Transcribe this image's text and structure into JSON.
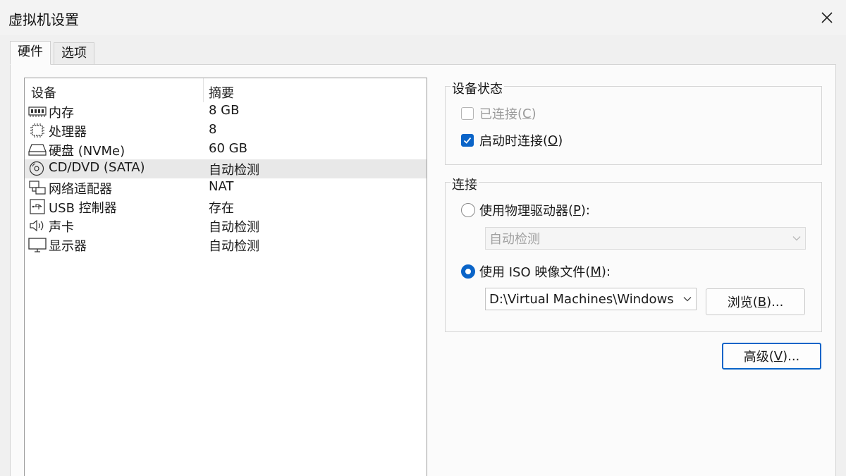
{
  "window": {
    "title": "虚拟机设置"
  },
  "tabs": [
    {
      "label": "硬件",
      "active": true
    },
    {
      "label": "选项",
      "active": false
    }
  ],
  "device_list": {
    "columns": [
      "设备",
      "摘要"
    ],
    "rows": [
      {
        "icon": "memory-icon",
        "name": "内存",
        "summary": "8 GB",
        "selected": false
      },
      {
        "icon": "processor-icon",
        "name": "处理器",
        "summary": "8",
        "selected": false
      },
      {
        "icon": "hard-disk-icon",
        "name": "硬盘 (NVMe)",
        "summary": "60 GB",
        "selected": false
      },
      {
        "icon": "cd-dvd-icon",
        "name": "CD/DVD (SATA)",
        "summary": "自动检测",
        "selected": true
      },
      {
        "icon": "network-adapter-icon",
        "name": "网络适配器",
        "summary": "NAT",
        "selected": false
      },
      {
        "icon": "usb-icon",
        "name": "USB 控制器",
        "summary": "存在",
        "selected": false
      },
      {
        "icon": "speaker-icon",
        "name": "声卡",
        "summary": "自动检测",
        "selected": false
      },
      {
        "icon": "monitor-icon",
        "name": "显示器",
        "summary": "自动检测",
        "selected": false
      }
    ]
  },
  "device_status": {
    "label": "设备状态",
    "connected": {
      "label": "已连接",
      "mnemonic": "C",
      "checked": false,
      "enabled": false
    },
    "connect_on_start": {
      "label": "启动时连接",
      "mnemonic": "O",
      "checked": true,
      "enabled": true
    }
  },
  "connection": {
    "label": "连接",
    "physical_drive": {
      "label": "使用物理驱动器",
      "mnemonic": "P",
      "selected": false
    },
    "physical_drive_select": {
      "value": "自动检测",
      "enabled": false
    },
    "iso_image": {
      "label": "使用 ISO 映像文件",
      "mnemonic": "M",
      "selected": true
    },
    "iso_path": {
      "value": "D:\\Virtual Machines\\Windows"
    },
    "browse_button": {
      "label": "浏览",
      "mnemonic": "B",
      "suffix": "..."
    }
  },
  "advanced_button": {
    "label": "高级",
    "mnemonic": "V",
    "suffix": "..."
  },
  "colors": {
    "accent": "#0a64c8",
    "background": "#f0f0f0",
    "panel": "#fbfbfb"
  }
}
